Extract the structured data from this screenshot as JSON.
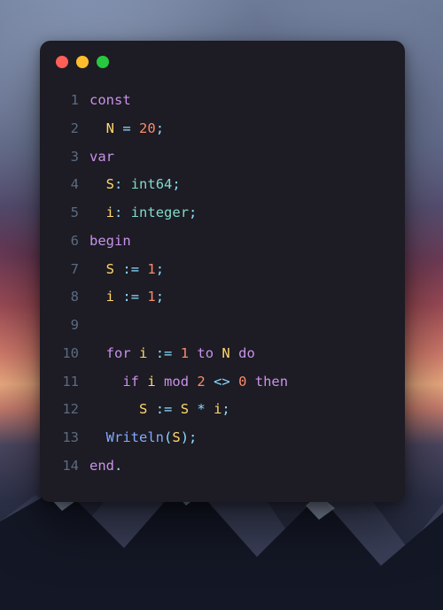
{
  "window": {
    "traffic_lights": {
      "close": "close",
      "minimize": "minimize",
      "zoom": "zoom"
    }
  },
  "code": {
    "lines": [
      {
        "n": "1",
        "tokens": [
          {
            "t": "const",
            "c": "kw"
          }
        ]
      },
      {
        "n": "2",
        "tokens": [
          {
            "t": "  ",
            "c": "pl"
          },
          {
            "t": "N",
            "c": "id"
          },
          {
            "t": " ",
            "c": "pl"
          },
          {
            "t": "=",
            "c": "op"
          },
          {
            "t": " ",
            "c": "pl"
          },
          {
            "t": "20",
            "c": "num"
          },
          {
            "t": ";",
            "c": "op"
          }
        ]
      },
      {
        "n": "3",
        "tokens": [
          {
            "t": "var",
            "c": "kw"
          }
        ]
      },
      {
        "n": "4",
        "tokens": [
          {
            "t": "  ",
            "c": "pl"
          },
          {
            "t": "S",
            "c": "id"
          },
          {
            "t": ":",
            "c": "op"
          },
          {
            "t": " ",
            "c": "pl"
          },
          {
            "t": "int64",
            "c": "ty"
          },
          {
            "t": ";",
            "c": "op"
          }
        ]
      },
      {
        "n": "5",
        "tokens": [
          {
            "t": "  ",
            "c": "pl"
          },
          {
            "t": "i",
            "c": "id"
          },
          {
            "t": ":",
            "c": "op"
          },
          {
            "t": " ",
            "c": "pl"
          },
          {
            "t": "integer",
            "c": "ty"
          },
          {
            "t": ";",
            "c": "op"
          }
        ]
      },
      {
        "n": "6",
        "tokens": [
          {
            "t": "begin",
            "c": "kw"
          }
        ]
      },
      {
        "n": "7",
        "tokens": [
          {
            "t": "  ",
            "c": "pl"
          },
          {
            "t": "S",
            "c": "id"
          },
          {
            "t": " ",
            "c": "pl"
          },
          {
            "t": ":=",
            "c": "op"
          },
          {
            "t": " ",
            "c": "pl"
          },
          {
            "t": "1",
            "c": "num"
          },
          {
            "t": ";",
            "c": "op"
          }
        ]
      },
      {
        "n": "8",
        "tokens": [
          {
            "t": "  ",
            "c": "pl"
          },
          {
            "t": "i",
            "c": "id"
          },
          {
            "t": " ",
            "c": "pl"
          },
          {
            "t": ":=",
            "c": "op"
          },
          {
            "t": " ",
            "c": "pl"
          },
          {
            "t": "1",
            "c": "num"
          },
          {
            "t": ";",
            "c": "op"
          }
        ]
      },
      {
        "n": "9",
        "tokens": [
          {
            "t": " ",
            "c": "pl"
          }
        ]
      },
      {
        "n": "10",
        "tokens": [
          {
            "t": "  ",
            "c": "pl"
          },
          {
            "t": "for",
            "c": "kw"
          },
          {
            "t": " ",
            "c": "pl"
          },
          {
            "t": "i",
            "c": "id"
          },
          {
            "t": " ",
            "c": "pl"
          },
          {
            "t": ":=",
            "c": "op"
          },
          {
            "t": " ",
            "c": "pl"
          },
          {
            "t": "1",
            "c": "num"
          },
          {
            "t": " ",
            "c": "pl"
          },
          {
            "t": "to",
            "c": "kw"
          },
          {
            "t": " ",
            "c": "pl"
          },
          {
            "t": "N",
            "c": "id"
          },
          {
            "t": " ",
            "c": "pl"
          },
          {
            "t": "do",
            "c": "kw"
          }
        ]
      },
      {
        "n": "11",
        "tokens": [
          {
            "t": "    ",
            "c": "pl"
          },
          {
            "t": "if",
            "c": "kw"
          },
          {
            "t": " ",
            "c": "pl"
          },
          {
            "t": "i",
            "c": "id"
          },
          {
            "t": " ",
            "c": "pl"
          },
          {
            "t": "mod",
            "c": "kw"
          },
          {
            "t": " ",
            "c": "pl"
          },
          {
            "t": "2",
            "c": "num"
          },
          {
            "t": " ",
            "c": "pl"
          },
          {
            "t": "<>",
            "c": "op"
          },
          {
            "t": " ",
            "c": "pl"
          },
          {
            "t": "0",
            "c": "num"
          },
          {
            "t": " ",
            "c": "pl"
          },
          {
            "t": "then",
            "c": "kw"
          }
        ]
      },
      {
        "n": "12",
        "tokens": [
          {
            "t": "      ",
            "c": "pl"
          },
          {
            "t": "S",
            "c": "id"
          },
          {
            "t": " ",
            "c": "pl"
          },
          {
            "t": ":=",
            "c": "op"
          },
          {
            "t": " ",
            "c": "pl"
          },
          {
            "t": "S",
            "c": "id"
          },
          {
            "t": " ",
            "c": "pl"
          },
          {
            "t": "*",
            "c": "op"
          },
          {
            "t": " ",
            "c": "pl"
          },
          {
            "t": "i",
            "c": "id"
          },
          {
            "t": ";",
            "c": "op"
          }
        ]
      },
      {
        "n": "13",
        "tokens": [
          {
            "t": "  ",
            "c": "pl"
          },
          {
            "t": "Writeln",
            "c": "fn"
          },
          {
            "t": "(",
            "c": "op"
          },
          {
            "t": "S",
            "c": "id"
          },
          {
            "t": ")",
            "c": "op"
          },
          {
            "t": ";",
            "c": "op"
          }
        ]
      },
      {
        "n": "14",
        "tokens": [
          {
            "t": "end",
            "c": "kw"
          },
          {
            "t": ".",
            "c": "op"
          }
        ]
      }
    ]
  }
}
